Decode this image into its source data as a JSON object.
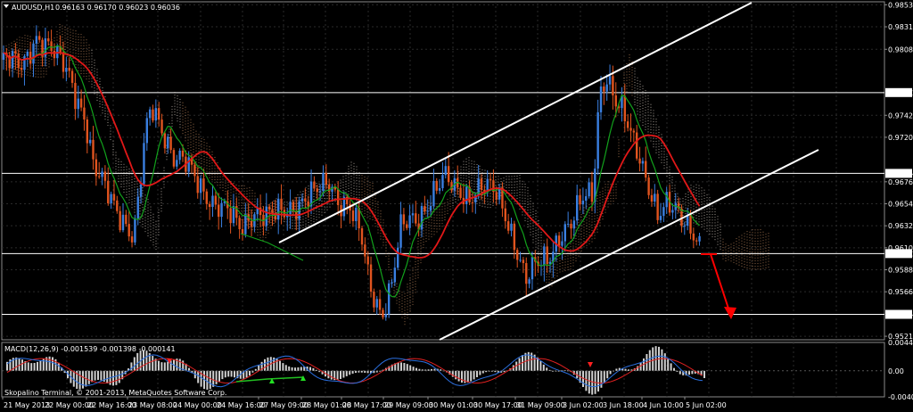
{
  "chart_data": [
    {
      "type": "candlestick",
      "title": "AUDUSD,H1",
      "ohlc": "0.96163 0.96170 0.96023 0.96036",
      "x_labels": [
        "21 May 2013",
        "22 May 00:00",
        "22 May 16:00",
        "23 May 08:00",
        "24 May 00:00",
        "24 May 16:00",
        "27 May 09:00",
        "28 May 01:00",
        "28 May 17:00",
        "29 May 09:00",
        "30 May 01:00",
        "30 May 17:00",
        "31 May 09:00",
        "3 Jun 02:00",
        "3 Jun 18:00",
        "4 Jun 10:00",
        "5 Jun 02:00"
      ],
      "y_ticks": [
        "0.98530",
        "0.98310",
        "0.98085",
        "0.97652",
        "0.97425",
        "0.97205",
        "0.96844",
        "0.96760",
        "0.96540",
        "0.96320",
        "0.96100",
        "0.96042",
        "0.95880",
        "0.95660",
        "0.95434",
        "0.95215"
      ],
      "ylim": [
        0.9518,
        0.9856
      ],
      "bid_price": "0.96042",
      "horizontal_levels": [
        0.97652,
        0.96844,
        0.96042,
        0.95434
      ],
      "colors": {
        "bull": "#3a7fe0",
        "bear": "#e0541f",
        "ma_slow": "#e11818",
        "ma_fast": "#12a21c",
        "cloud_bear": "#e8dcd0",
        "cloud_bull": "#d89a6a",
        "channel": "#ffffff",
        "forecast_arrow": "#ff0000",
        "grid": "#2a2a2a",
        "level": "#ffffff"
      },
      "grid": true
    },
    {
      "type": "macd",
      "title": "MACD(12,26,9) -0.001539 -0.001398 -0.000141",
      "y_ticks": [
        "0.00440",
        "0.00",
        "-0.00404"
      ],
      "ylim": [
        -0.00404,
        0.0044
      ]
    }
  ],
  "footer": "Skopalino Terminal, © 2001-2013, MetaQuotes Software Corp."
}
